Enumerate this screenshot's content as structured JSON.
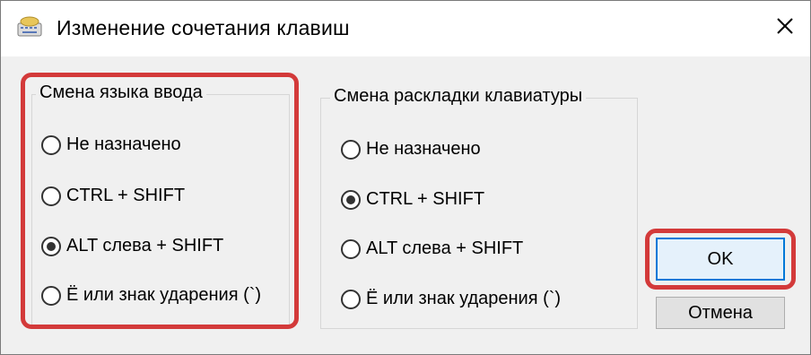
{
  "window": {
    "title": "Изменение сочетания клавиш"
  },
  "icons": {
    "app": "keyboard-icon",
    "close": "close-icon"
  },
  "colors": {
    "highlight": "#d33a3a",
    "default_button_border": "#0078d7"
  },
  "input_language": {
    "title": "Смена языка ввода",
    "options": [
      "Не назначено",
      "CTRL + SHIFT",
      "ALT слева + SHIFT",
      "Ё или знак ударения (`)"
    ],
    "selected": "ALT слева + SHIFT"
  },
  "keyboard_layout": {
    "title": "Смена раскладки клавиатуры",
    "options": [
      "Не назначено",
      "CTRL + SHIFT",
      "ALT слева + SHIFT",
      "Ё или знак ударения (`)"
    ],
    "selected": "CTRL + SHIFT"
  },
  "buttons": {
    "ok": "OK",
    "cancel": "Отмена"
  }
}
